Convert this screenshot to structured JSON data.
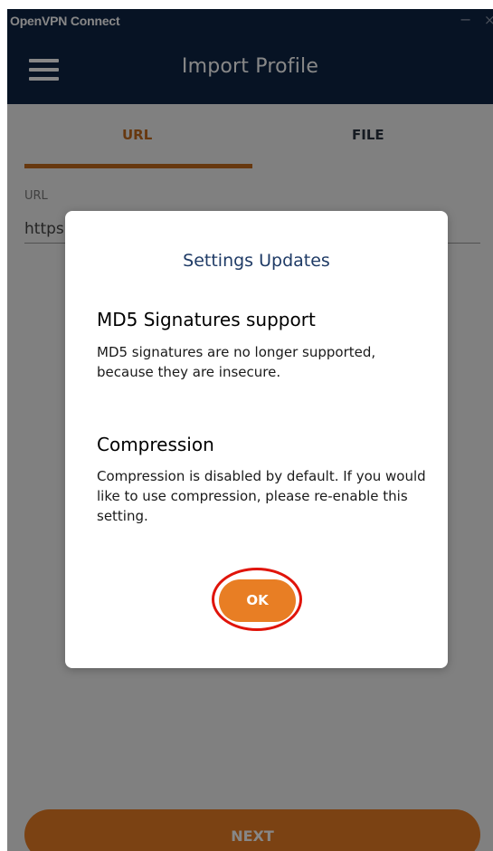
{
  "window": {
    "title": "OpenVPN Connect",
    "minimize_glyph": "−",
    "close_glyph": "×"
  },
  "header": {
    "title": "Import Profile",
    "menu_icon": "hamburger-menu-icon"
  },
  "tabs": [
    {
      "label": "URL",
      "active": true
    },
    {
      "label": "FILE",
      "active": false
    }
  ],
  "url_field": {
    "label": "URL",
    "value": "https:"
  },
  "next_button": {
    "label": "NEXT"
  },
  "dialog": {
    "title": "Settings Updates",
    "sections": [
      {
        "heading": "MD5 Signatures support",
        "body": "MD5 signatures are no longer supported, because they are insecure."
      },
      {
        "heading": "Compression",
        "body": "Compression is disabled by default. If you would like to use compression, please re-enable this setting."
      }
    ],
    "ok_label": "OK"
  },
  "colors": {
    "navy": "#0f2445",
    "accent_orange": "#e87e24",
    "tab_active": "#c26a1d",
    "dialog_title": "#1f3b66",
    "highlight_ring": "#e0140a"
  }
}
